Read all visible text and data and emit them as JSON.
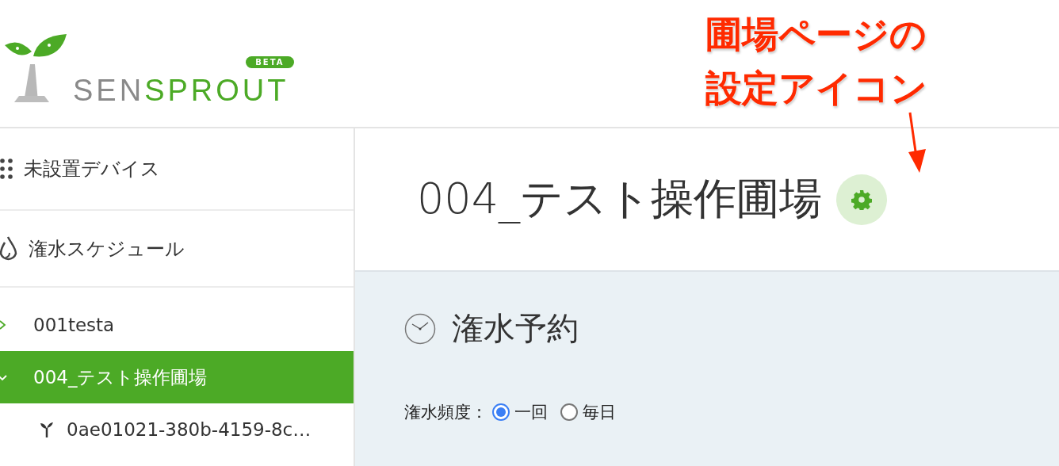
{
  "logo": {
    "parts": [
      "SEN",
      "SPROUT"
    ],
    "badge": "BETA"
  },
  "annotation": {
    "lines": [
      "圃場ページの",
      "設定アイコン"
    ]
  },
  "sidebar": {
    "items": [
      {
        "kind": "devices",
        "label": "未設置デバイス"
      },
      {
        "kind": "schedule",
        "label": "潅水スケジュール"
      }
    ],
    "tree": [
      {
        "label": "001testa",
        "expanded": false,
        "selected": false
      },
      {
        "label": "004_テスト操作圃場",
        "expanded": true,
        "selected": true,
        "children": [
          {
            "label": "0ae01021-380b-4159-8c…",
            "selected": false
          }
        ]
      }
    ]
  },
  "page": {
    "title": "004_テスト操作圃場"
  },
  "section": {
    "title": "潅水予約",
    "frequency_label": "潅水頻度：",
    "options": [
      {
        "label": "一回",
        "selected": true
      },
      {
        "label": "毎日",
        "selected": false
      }
    ]
  }
}
